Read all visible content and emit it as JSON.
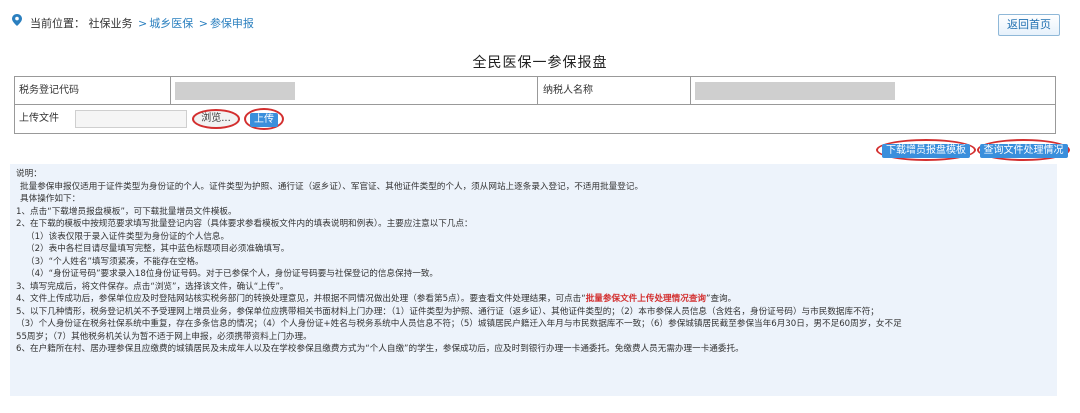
{
  "breadcrumb": {
    "current_label": "当前位置：",
    "section": "社保业务",
    "sep": ">",
    "link1": "城乡医保",
    "link2": "参保申报"
  },
  "header": {
    "home_button": "返回首页"
  },
  "page_title": "全民医保一参保报盘",
  "form": {
    "tax_code_label": "税务登记代码",
    "taxpayer_name_label": "纳税人名称",
    "upload_label": "上传文件",
    "browse_button": "浏览...",
    "upload_button": "上传"
  },
  "actions": {
    "download_template": "下载增员报盘模板",
    "query_status": "查询文件处理情况"
  },
  "notes": {
    "title": "说明：",
    "lines": {
      "l1": "批量参保申报仅适用于证件类型为身份证的个人。证件类型为护照、通行证（返乡证）、军官证、其他证件类型的个人，须从网站上逐条录入登记，不适用批量登记。",
      "l2": "具体操作如下：",
      "l3": "1、点击“下载增员报盘模板”，可下载批量增员文件模板。",
      "l4": "2、在下载的模板中按规范要求填写批量登记内容（具体要求参看模板文件内的填表说明和例表）。主要应注意以下几点：",
      "l5": "（1）该表仅限于录入证件类型为身份证的个人信息。",
      "l6": "（2）表中各栏目请尽量填写完整，其中蓝色标题项目必须准确填写。",
      "l7": "（3）“个人姓名”填写须紧凑，不能存在空格。",
      "l8": "（4）“身份证号码”要求录入18位身份证号码。对于已参保个人，身份证号码要与社保登记的信息保持一致。",
      "l9": "3、填写完成后，将文件保存。点击“浏览”，选择该文件，确认“上传”。",
      "l10a": "4、文件上传成功后，参保单位应及时登陆网站核实税务部门的转换处理意见，并根据不同情况做出处理（参看第5点）。要查看文件处理结果，可点击“",
      "l10b": "批量参保文件上传处理情况查询",
      "l10c": "”查询。",
      "l11": "5、以下几种情形，税务登记机关不予受理网上增员业务，参保单位应携带相关书面材料上门办理：（1）证件类型为护照、通行证（返乡证）、其他证件类型的；（2）本市参保人员信息（含姓名，身份证号码）与市民数据库不符；",
      "l12": "（3）个人身份证在税务社保系统中重复，存在多条信息的情况；（4）个人身份证+姓名与税务系统中人员信息不符；（5）城镇居民户籍迁入年月与市民数据库不一致；（6）参保城镇居民截至参保当年6月30日，男不足60周岁，女不足",
      "l13": "55周岁；（7）其他税务机关认为暂不适于网上申报，必须携带资料上门办理。",
      "l14": "6、在户籍所在村、居办理参保且应缴费的城镇居民及未成年人以及在学校参保且缴费方式为“个人自缴”的学生，参保成功后，应及时到银行办理一卡通委托。免缴费人员无需办理一卡通委托。"
    }
  },
  "colors": {
    "accent": "#2a7fbf",
    "button": "#3a8fdc",
    "highlight_ring": "#d32f2f",
    "notes_bg": "#edf3fb"
  }
}
